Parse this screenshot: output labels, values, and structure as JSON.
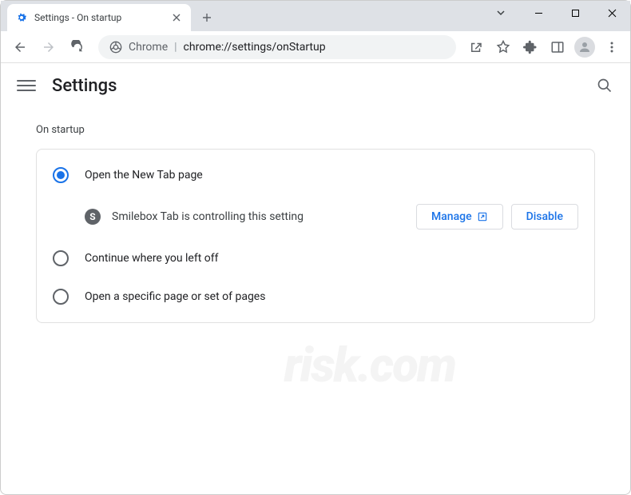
{
  "tab": {
    "title": "Settings - On startup"
  },
  "omnibox": {
    "scheme_label": "Chrome",
    "url_path": "chrome://settings/onStartup"
  },
  "settings": {
    "title": "Settings"
  },
  "content": {
    "section_title": "On startup",
    "options": [
      {
        "label": "Open the New Tab page",
        "selected": true
      },
      {
        "label": "Continue where you left off",
        "selected": false
      },
      {
        "label": "Open a specific page or set of pages",
        "selected": false
      }
    ],
    "extension_notice": {
      "icon_letter": "S",
      "text": "Smilebox Tab is controlling this setting",
      "manage_label": "Manage",
      "disable_label": "Disable"
    }
  }
}
